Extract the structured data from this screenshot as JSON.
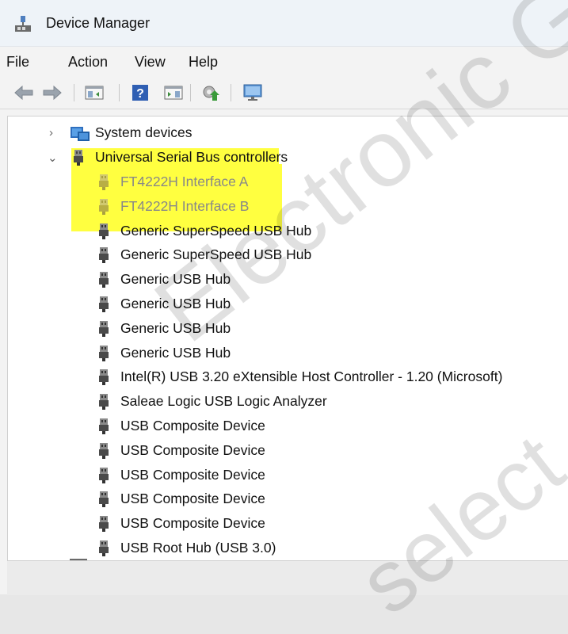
{
  "window": {
    "title": "Device Manager",
    "title_icon": "device-manager-icon"
  },
  "menubar": {
    "items": [
      "File",
      "Action",
      "View",
      "Help"
    ]
  },
  "toolbar": {
    "buttons": [
      {
        "name": "back-arrow-icon"
      },
      {
        "name": "forward-arrow-icon"
      },
      {
        "name": "properties-pane-icon"
      },
      {
        "name": "help-icon"
      },
      {
        "name": "details-pane-icon"
      },
      {
        "name": "update-driver-icon"
      },
      {
        "name": "scan-hardware-icon"
      }
    ]
  },
  "tree": {
    "categories": [
      {
        "label": "System devices",
        "expanded": false,
        "icon": "system-devices-icon"
      },
      {
        "label": "Universal Serial Bus controllers",
        "expanded": true,
        "icon": "usb-controller-icon"
      }
    ],
    "usb_devices": [
      {
        "label": "FT4222H Interface A",
        "disabled": true
      },
      {
        "label": "FT4222H Interface B",
        "disabled": true
      },
      {
        "label": "Generic SuperSpeed USB Hub",
        "disabled": false
      },
      {
        "label": "Generic SuperSpeed USB Hub",
        "disabled": false
      },
      {
        "label": "Generic USB Hub",
        "disabled": false
      },
      {
        "label": "Generic USB Hub",
        "disabled": false
      },
      {
        "label": "Generic USB Hub",
        "disabled": false
      },
      {
        "label": "Generic USB Hub",
        "disabled": false
      },
      {
        "label": "Intel(R) USB 3.20 eXtensible Host Controller - 1.20 (Microsoft)",
        "disabled": false
      },
      {
        "label": "Saleae Logic USB Logic Analyzer",
        "disabled": false
      },
      {
        "label": "USB Composite Device",
        "disabled": false
      },
      {
        "label": "USB Composite Device",
        "disabled": false
      },
      {
        "label": "USB Composite Device",
        "disabled": false
      },
      {
        "label": "USB Composite Device",
        "disabled": false
      },
      {
        "label": "USB Composite Device",
        "disabled": false
      },
      {
        "label": "USB Root Hub (USB 3.0)",
        "disabled": false
      }
    ]
  },
  "watermark": {
    "line1": "Electronic Group",
    "line2": "select.com"
  },
  "colors": {
    "highlight": "#ffff00",
    "disabled_text": "#888888"
  }
}
